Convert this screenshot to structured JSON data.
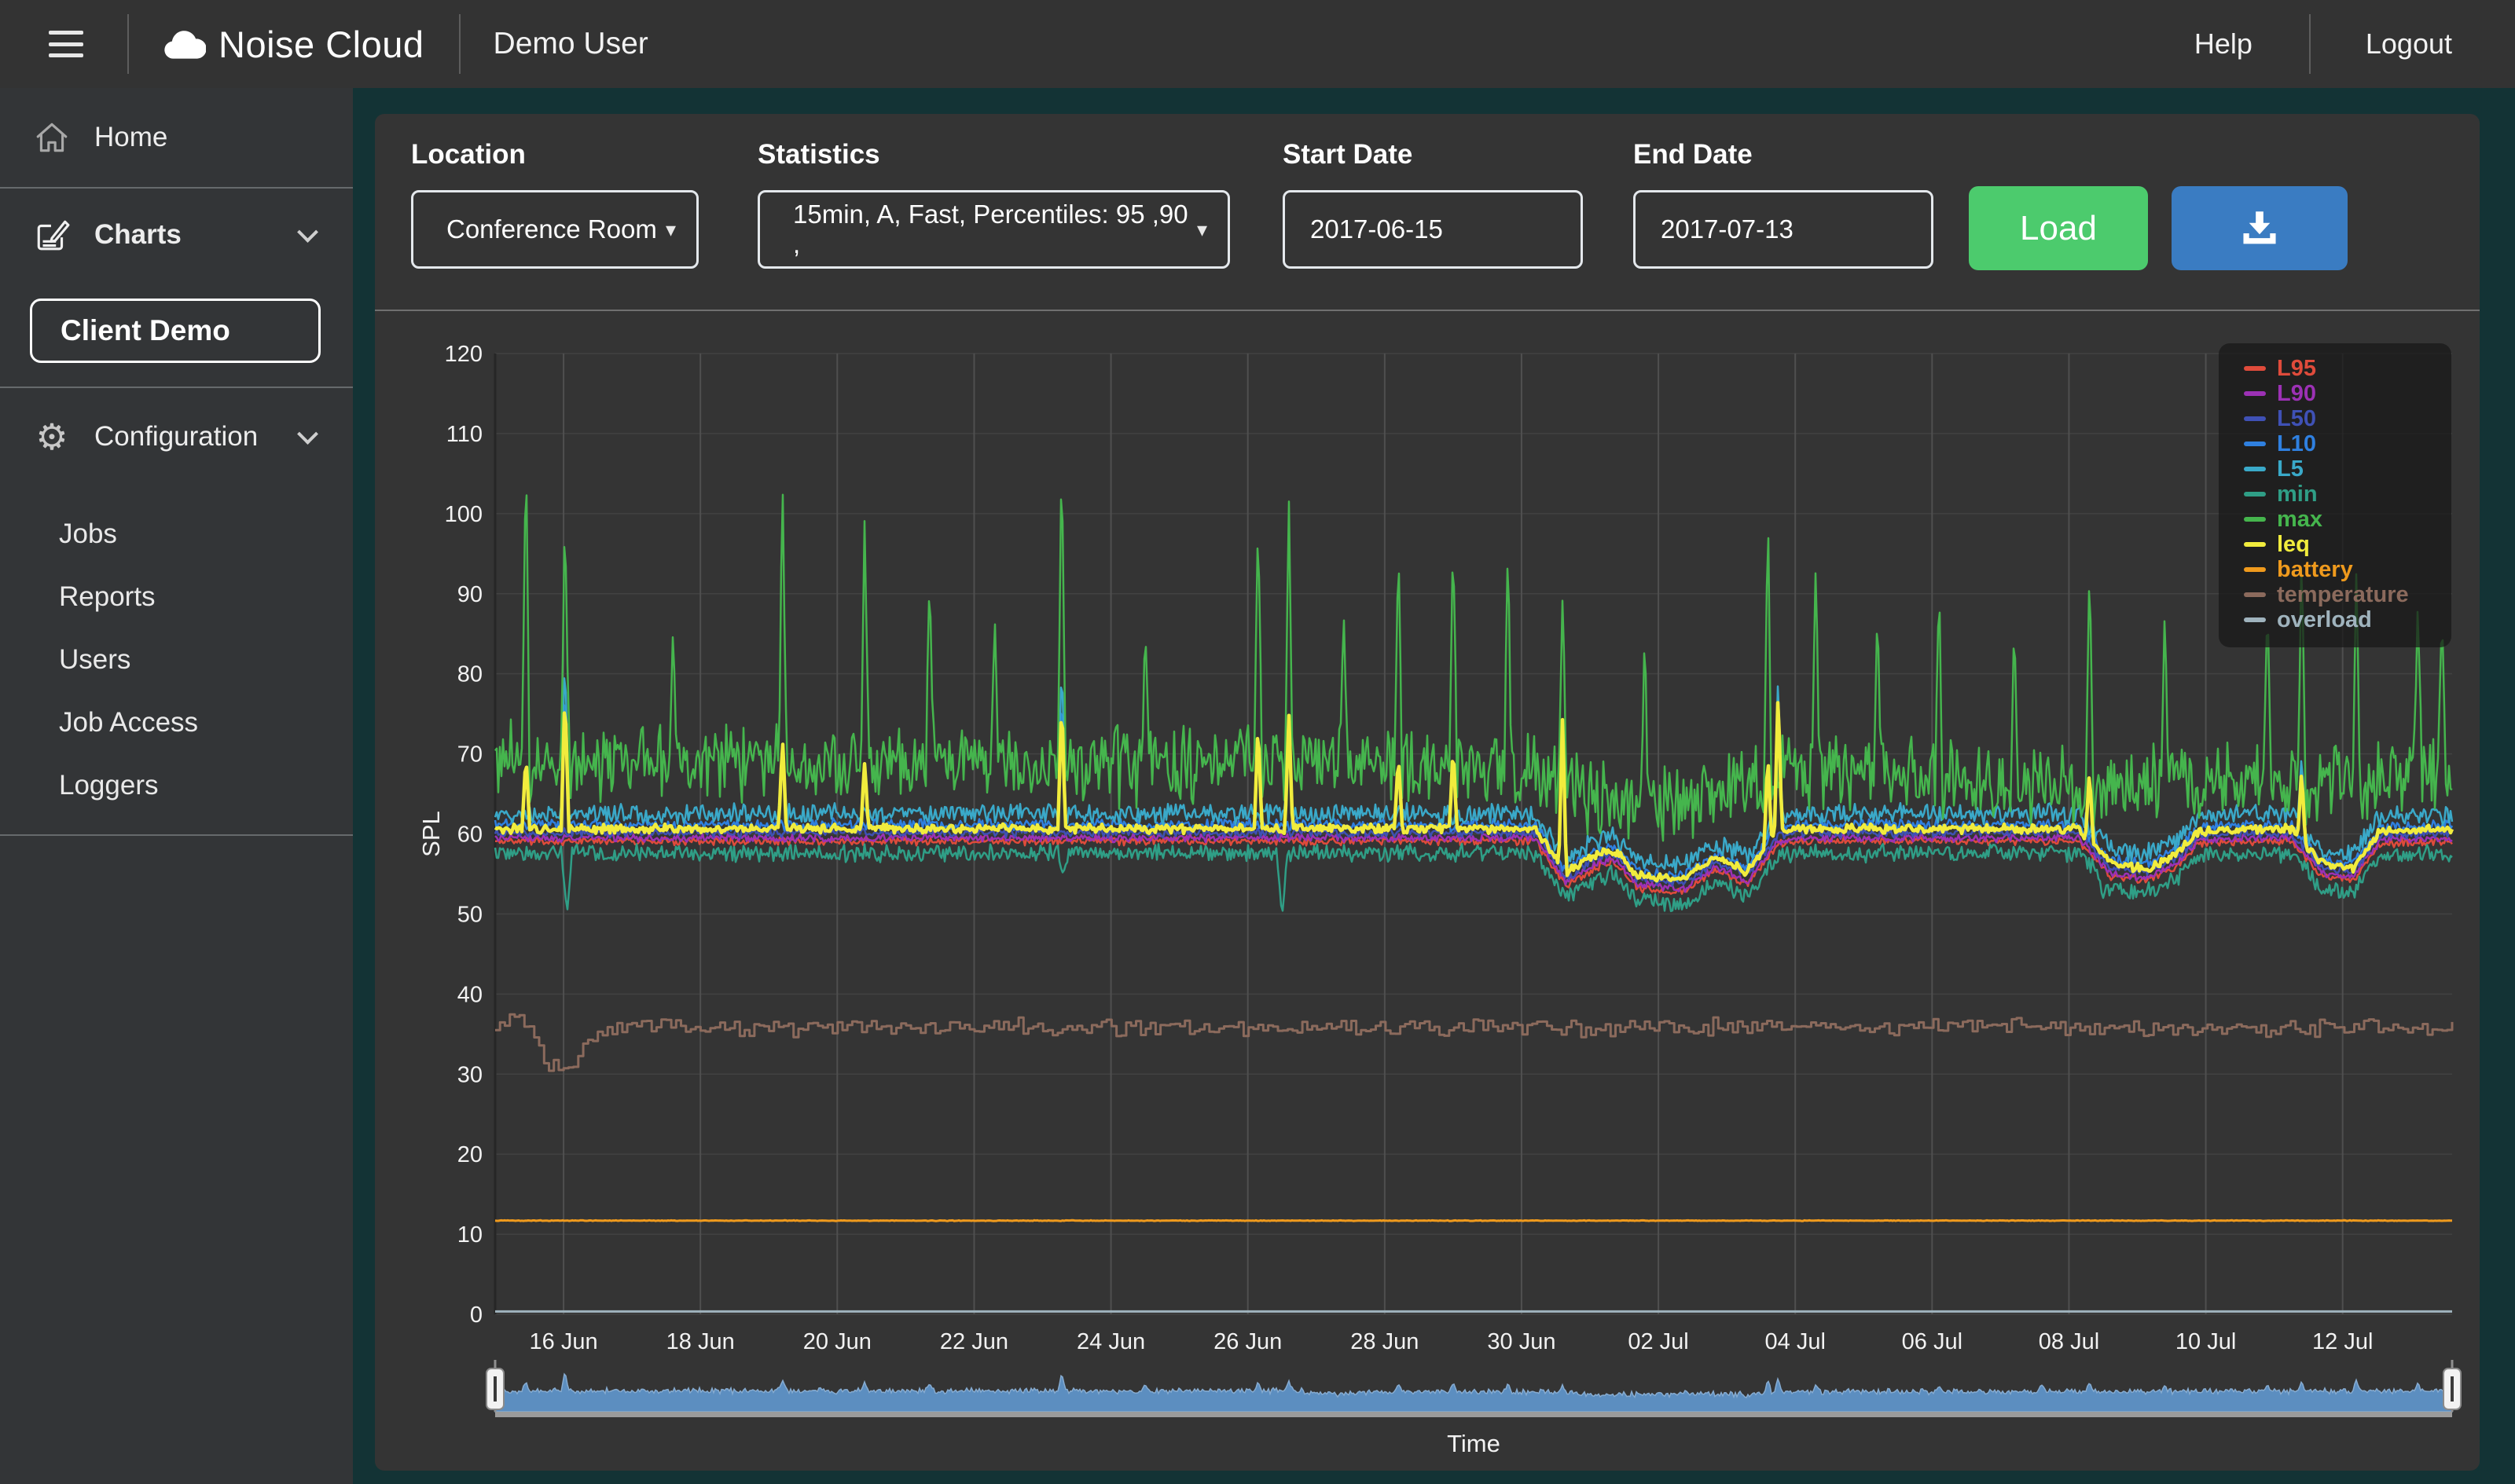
{
  "header": {
    "brand": "Noise Cloud",
    "user": "Demo User",
    "help": "Help",
    "logout": "Logout"
  },
  "sidebar": {
    "home": "Home",
    "charts": "Charts",
    "client_demo": "Client Demo",
    "configuration": "Configuration",
    "sub_items": [
      "Jobs",
      "Reports",
      "Users",
      "Job Access",
      "Loggers"
    ]
  },
  "form": {
    "location_label": "Location",
    "location_value": "Conference Room",
    "statistics_label": "Statistics",
    "statistics_value": "15min, A, Fast, Percentiles: 95 ,90 ,",
    "start_label": "Start Date",
    "start_value": "2017-06-15",
    "end_label": "End Date",
    "end_value": "2017-07-13",
    "load_label": "Load",
    "select_arrow": "▾"
  },
  "colors": {
    "page_bg": "#133335",
    "chrome_bg": "#333333",
    "panel_bg": "#343434",
    "accent_green": "#4ccb6d",
    "accent_blue": "#3a7cc2",
    "grid_v": "#4f4f4f",
    "grid_h": "#424242",
    "axis_text": "#f2f2f2",
    "navigator_fill": "#5f94c8",
    "navigator_line": "#86abd0",
    "scrollbar_track": "#9b9b9b"
  },
  "chart_data": {
    "type": "line",
    "title": "",
    "xlabel": "Time",
    "ylabel": "SPL",
    "ylim": [
      0,
      120
    ],
    "y_tick_step": 10,
    "x_range_days": [
      0,
      28.6
    ],
    "x_epoch": "2017-06-15",
    "grid": true,
    "legend_position": "top-right",
    "x_ticks": [
      {
        "day": 1,
        "label": "16 Jun"
      },
      {
        "day": 3,
        "label": "18 Jun"
      },
      {
        "day": 5,
        "label": "20 Jun"
      },
      {
        "day": 7,
        "label": "22 Jun"
      },
      {
        "day": 9,
        "label": "24 Jun"
      },
      {
        "day": 11,
        "label": "26 Jun"
      },
      {
        "day": 13,
        "label": "28 Jun"
      },
      {
        "day": 15,
        "label": "30 Jun"
      },
      {
        "day": 17,
        "label": "02 Jul"
      },
      {
        "day": 19,
        "label": "04 Jul"
      },
      {
        "day": 21,
        "label": "06 Jul"
      },
      {
        "day": 23,
        "label": "08 Jul"
      },
      {
        "day": 25,
        "label": "10 Jul"
      },
      {
        "day": 27,
        "label": "12 Jul"
      }
    ],
    "cluster_profile": [
      [
        0,
        0
      ],
      [
        15.2,
        0
      ],
      [
        15.65,
        -5.6
      ],
      [
        16.1,
        -3.2
      ],
      [
        16.35,
        -2.6
      ],
      [
        16.7,
        -5.8
      ],
      [
        17.35,
        -6.4
      ],
      [
        17.85,
        -3.6
      ],
      [
        18.3,
        -5.4
      ],
      [
        18.75,
        -0.3
      ],
      [
        19.1,
        0
      ],
      [
        23.15,
        0
      ],
      [
        23.6,
        -4.3
      ],
      [
        24.1,
        -5.0
      ],
      [
        24.55,
        -3.4
      ],
      [
        24.9,
        -0.2
      ],
      [
        26.25,
        0
      ],
      [
        26.7,
        -4.4
      ],
      [
        27.15,
        -4.9
      ],
      [
        27.55,
        -0.3
      ],
      [
        28.6,
        0
      ]
    ],
    "spike_halfwidth_days": 0.055,
    "series": [
      {
        "name": "L95",
        "color": "#df4b3b",
        "width": 2.5,
        "base": 59.2,
        "use_profile": true,
        "nup": 0.5,
        "ndown": 0.7,
        "seed": 11
      },
      {
        "name": "L90",
        "color": "#9c31b5",
        "width": 2.5,
        "base": 59.6,
        "use_profile": true,
        "nup": 0.5,
        "ndown": 0.7,
        "seed": 22
      },
      {
        "name": "L50",
        "color": "#3f51b5",
        "width": 2.5,
        "base": 60.2,
        "use_profile": true,
        "nup": 0.6,
        "ndown": 0.7,
        "seed": 33
      },
      {
        "name": "L10",
        "color": "#2f80e0",
        "width": 2.5,
        "base": 61.0,
        "use_profile": true,
        "nup": 1.0,
        "ndown": 0.7,
        "seed": 44,
        "spikes": [
          [
            1.02,
            79
          ],
          [
            8.28,
            78
          ],
          [
            18.75,
            74
          ]
        ]
      },
      {
        "name": "L5",
        "color": "#3aa9c9",
        "width": 2.5,
        "base": 61.9,
        "use_profile": true,
        "nup": 2.0,
        "ndown": 0.8,
        "seed": 55,
        "spikes": [
          [
            1.02,
            83
          ],
          [
            4.2,
            72
          ],
          [
            8.28,
            82
          ],
          [
            11.6,
            74
          ],
          [
            15.6,
            72
          ],
          [
            18.75,
            80
          ],
          [
            26.4,
            70
          ]
        ]
      },
      {
        "name": "min",
        "color": "#2f9e86",
        "width": 2.5,
        "base": 58.2,
        "use_profile": true,
        "nup": 0.6,
        "ndown": 1.8,
        "seed": 66,
        "dips": [
          [
            1.05,
            50
          ],
          [
            8.3,
            55
          ],
          [
            11.5,
            49.5
          ],
          [
            23.5,
            52
          ]
        ]
      },
      {
        "name": "max",
        "color": "#45b54d",
        "width": 2.5,
        "nup": 7.2,
        "ndown": 3.8,
        "seed": 77,
        "points": [
          [
            0,
            67.5
          ],
          [
            4,
            67.2
          ],
          [
            8,
            66.6
          ],
          [
            11,
            67.2
          ],
          [
            15.2,
            66.6
          ],
          [
            16.1,
            62.8
          ],
          [
            17.5,
            62.3
          ],
          [
            18.8,
            66.2
          ],
          [
            23.4,
            64.0
          ],
          [
            24.5,
            64.5
          ],
          [
            26.8,
            64.5
          ],
          [
            28.6,
            66.3
          ]
        ],
        "spikes": [
          [
            0.45,
            109
          ],
          [
            1.02,
            101
          ],
          [
            2.6,
            86
          ],
          [
            4.2,
            105
          ],
          [
            5.4,
            100
          ],
          [
            6.35,
            93
          ],
          [
            7.3,
            88
          ],
          [
            8.28,
            109
          ],
          [
            9.5,
            87
          ],
          [
            11.15,
            100
          ],
          [
            11.6,
            102
          ],
          [
            12.4,
            88
          ],
          [
            13.2,
            97
          ],
          [
            14.0,
            98
          ],
          [
            14.8,
            96
          ],
          [
            15.6,
            90
          ],
          [
            16.8,
            86
          ],
          [
            18.6,
            101
          ],
          [
            19.3,
            94
          ],
          [
            20.2,
            88
          ],
          [
            21.1,
            92
          ],
          [
            22.2,
            86
          ],
          [
            23.3,
            94
          ],
          [
            24.4,
            88
          ],
          [
            25.9,
            90
          ],
          [
            26.4,
            96
          ],
          [
            27.2,
            93
          ],
          [
            28.1,
            90
          ],
          [
            28.45,
            88
          ]
        ]
      },
      {
        "name": "leq",
        "color": "#f1ec3d",
        "width": 4.5,
        "base": 60.6,
        "use_profile": true,
        "nup": 0.7,
        "ndown": 0.6,
        "seed": 88,
        "spikes": [
          [
            0.45,
            70
          ],
          [
            1.02,
            78
          ],
          [
            4.2,
            72
          ],
          [
            5.4,
            69
          ],
          [
            8.28,
            77
          ],
          [
            11.15,
            74
          ],
          [
            11.6,
            75
          ],
          [
            13.2,
            70
          ],
          [
            14.0,
            71
          ],
          [
            15.6,
            75
          ],
          [
            18.6,
            70
          ],
          [
            18.75,
            78
          ],
          [
            23.3,
            68
          ],
          [
            26.4,
            68
          ]
        ]
      },
      {
        "name": "battery",
        "color": "#ef9a1d",
        "width": 3,
        "nup": 0.05,
        "ndown": 0.05,
        "seed": 5,
        "points": [
          [
            0,
            11.7
          ],
          [
            28.6,
            11.7
          ]
        ]
      },
      {
        "name": "temperature",
        "color": "#8b6a5c",
        "width": 3,
        "nup": 1.3,
        "ndown": 1.3,
        "seed": 99,
        "step": true,
        "points": [
          [
            0,
            36.2
          ],
          [
            0.25,
            37.8
          ],
          [
            0.55,
            35.5
          ],
          [
            0.75,
            30.8
          ],
          [
            0.95,
            31.5
          ],
          [
            1.1,
            30.2
          ],
          [
            1.35,
            33.8
          ],
          [
            1.7,
            35.8
          ],
          [
            2.5,
            35.8
          ],
          [
            28.6,
            35.8
          ]
        ]
      },
      {
        "name": "overload",
        "color": "#9fb3bd",
        "width": 3,
        "nup": 0,
        "ndown": 0,
        "seed": 3,
        "points": [
          [
            0,
            0.35
          ],
          [
            28.6,
            0.35
          ]
        ]
      }
    ],
    "navigator": {
      "color_fill": "#5f94c8",
      "color_line": "#86abd0",
      "seed": 7,
      "nup": 8,
      "ndown": 6,
      "points": [
        [
          0,
          42
        ],
        [
          11.8,
          42
        ],
        [
          12.3,
          34
        ],
        [
          12.8,
          40
        ],
        [
          15.3,
          40
        ],
        [
          16.0,
          34
        ],
        [
          17.5,
          36
        ],
        [
          18.3,
          34
        ],
        [
          18.8,
          40
        ],
        [
          28.6,
          42
        ]
      ],
      "spikes": [
        [
          0.45,
          62
        ],
        [
          1.02,
          84
        ],
        [
          4.2,
          66
        ],
        [
          5.4,
          62
        ],
        [
          6.35,
          58
        ],
        [
          8.28,
          80
        ],
        [
          9.5,
          56
        ],
        [
          11.15,
          62
        ],
        [
          11.6,
          64
        ],
        [
          13.2,
          58
        ],
        [
          14.0,
          60
        ],
        [
          14.8,
          58
        ],
        [
          15.6,
          56
        ],
        [
          18.6,
          66
        ],
        [
          18.75,
          70
        ],
        [
          19.3,
          56
        ],
        [
          21.1,
          54
        ],
        [
          22.6,
          56
        ],
        [
          23.3,
          60
        ],
        [
          24.4,
          54
        ],
        [
          25.9,
          56
        ],
        [
          26.4,
          62
        ],
        [
          27.2,
          66
        ],
        [
          28.1,
          60
        ]
      ]
    }
  }
}
